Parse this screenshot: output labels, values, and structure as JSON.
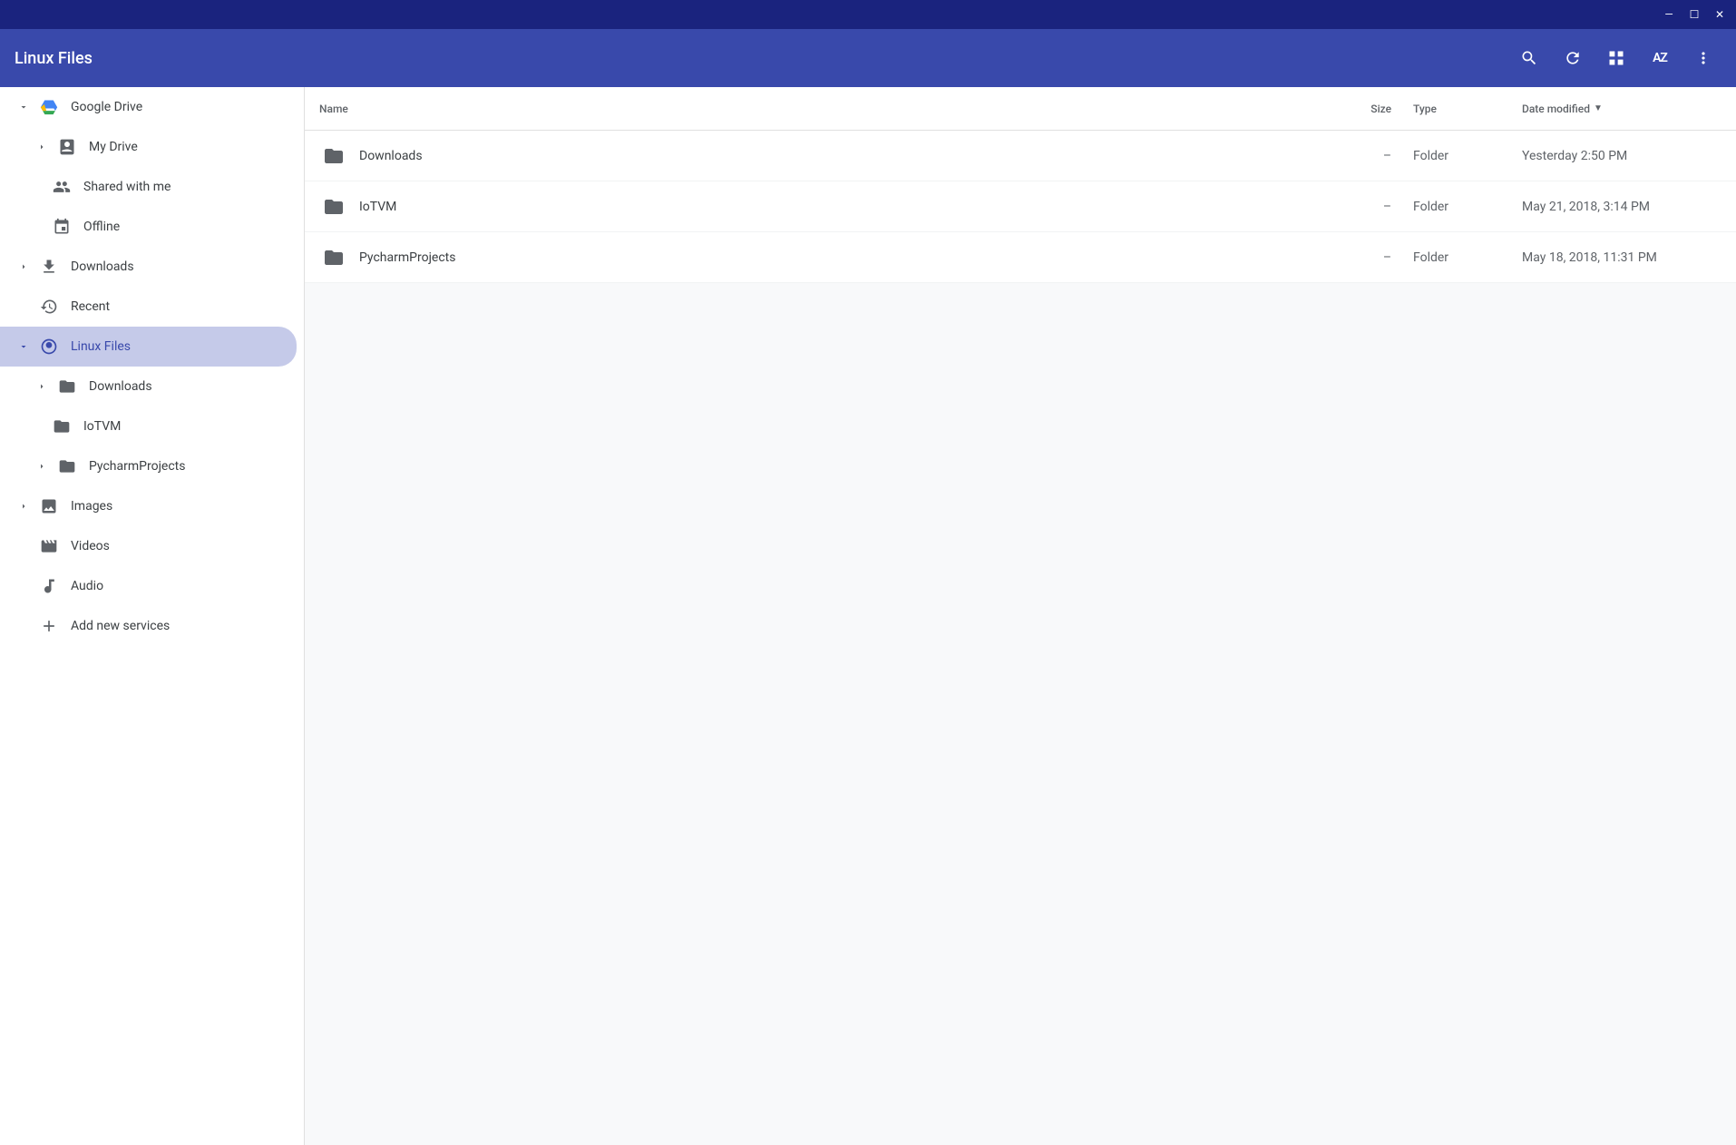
{
  "window": {
    "title": "Linux Files",
    "titlebar_buttons": {
      "minimize": "—",
      "maximize": "☐",
      "close": "✕"
    }
  },
  "header": {
    "title": "Linux Files",
    "search_tooltip": "Search",
    "refresh_tooltip": "Refresh",
    "view_tooltip": "Switch to grid view",
    "sort_tooltip": "Sort",
    "more_tooltip": "More"
  },
  "sidebar": {
    "sections": [
      {
        "id": "google-drive",
        "label": "Google Drive",
        "expanded": true,
        "indent": 0,
        "icon": "drive",
        "chevron": "down"
      },
      {
        "id": "my-drive",
        "label": "My Drive",
        "expanded": false,
        "indent": 1,
        "icon": "mydrive",
        "chevron": "right"
      },
      {
        "id": "shared-with-me",
        "label": "Shared with me",
        "indent": 1,
        "icon": "shared"
      },
      {
        "id": "offline",
        "label": "Offline",
        "indent": 1,
        "icon": "offline"
      },
      {
        "id": "downloads",
        "label": "Downloads",
        "expanded": false,
        "indent": 0,
        "icon": "download",
        "chevron": "right"
      },
      {
        "id": "recent",
        "label": "Recent",
        "indent": 0,
        "icon": "recent"
      },
      {
        "id": "linux-files",
        "label": "Linux Files",
        "expanded": true,
        "indent": 0,
        "icon": "linux",
        "chevron": "down",
        "active": true
      },
      {
        "id": "linux-downloads",
        "label": "Downloads",
        "expanded": false,
        "indent": 1,
        "icon": "folder",
        "chevron": "right"
      },
      {
        "id": "linux-iotvm",
        "label": "IoTVM",
        "indent": 1,
        "icon": "folder"
      },
      {
        "id": "linux-pycharm",
        "label": "PycharmProjects",
        "expanded": false,
        "indent": 1,
        "icon": "folder",
        "chevron": "right"
      },
      {
        "id": "images",
        "label": "Images",
        "expanded": false,
        "indent": 0,
        "icon": "images",
        "chevron": "right"
      },
      {
        "id": "videos",
        "label": "Videos",
        "indent": 0,
        "icon": "videos"
      },
      {
        "id": "audio",
        "label": "Audio",
        "indent": 0,
        "icon": "audio"
      },
      {
        "id": "add-new-services",
        "label": "Add new services",
        "indent": 0,
        "icon": "add"
      }
    ]
  },
  "table": {
    "columns": {
      "name": "Name",
      "size": "Size",
      "type": "Type",
      "date": "Date modified"
    },
    "rows": [
      {
        "name": "Downloads",
        "size": "–",
        "type": "Folder",
        "date": "Yesterday 2:50 PM"
      },
      {
        "name": "IoTVM",
        "size": "–",
        "type": "Folder",
        "date": "May 21, 2018, 3:14 PM"
      },
      {
        "name": "PycharmProjects",
        "size": "–",
        "type": "Folder",
        "date": "May 18, 2018, 11:31 PM"
      }
    ]
  }
}
